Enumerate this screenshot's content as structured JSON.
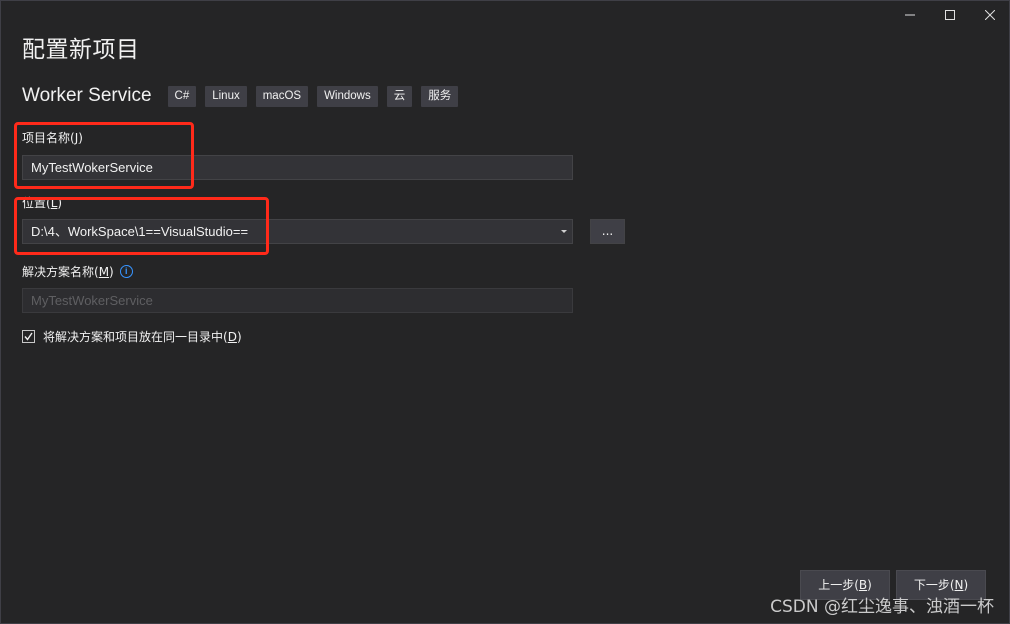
{
  "dialog": {
    "title": "配置新项目"
  },
  "template": {
    "name": "Worker Service",
    "tags": [
      "C#",
      "Linux",
      "macOS",
      "Windows",
      "云",
      "服务"
    ]
  },
  "fields": {
    "project_name": {
      "label": "项目名称(",
      "mnemonic": "J",
      "label_end": ")",
      "value": "MyTestWokerService"
    },
    "location": {
      "label": "位置(",
      "mnemonic": "L",
      "label_end": ")",
      "value": "D:\\4、WorkSpace\\1==VisualStudio==",
      "browse_label": "..."
    },
    "solution_name": {
      "label": "解决方案名称(",
      "mnemonic": "M",
      "label_end": ")",
      "placeholder": "MyTestWokerService"
    }
  },
  "same_directory": {
    "checked": true,
    "label": "将解决方案和项目放在同一目录中(",
    "mnemonic": "D",
    "label_end": ")"
  },
  "footer": {
    "back": {
      "label": "上一步(",
      "mnemonic": "B",
      "label_end": ")"
    },
    "next": {
      "label": "下一步(",
      "mnemonic": "N",
      "label_end": ")"
    }
  },
  "watermark": "CSDN @红尘逸事、浊酒一杯",
  "colors": {
    "background": "#252526",
    "input_bg": "#333337",
    "tag_bg": "#3f3f46",
    "highlight": "#ff2a1a",
    "info": "#3794ff"
  }
}
